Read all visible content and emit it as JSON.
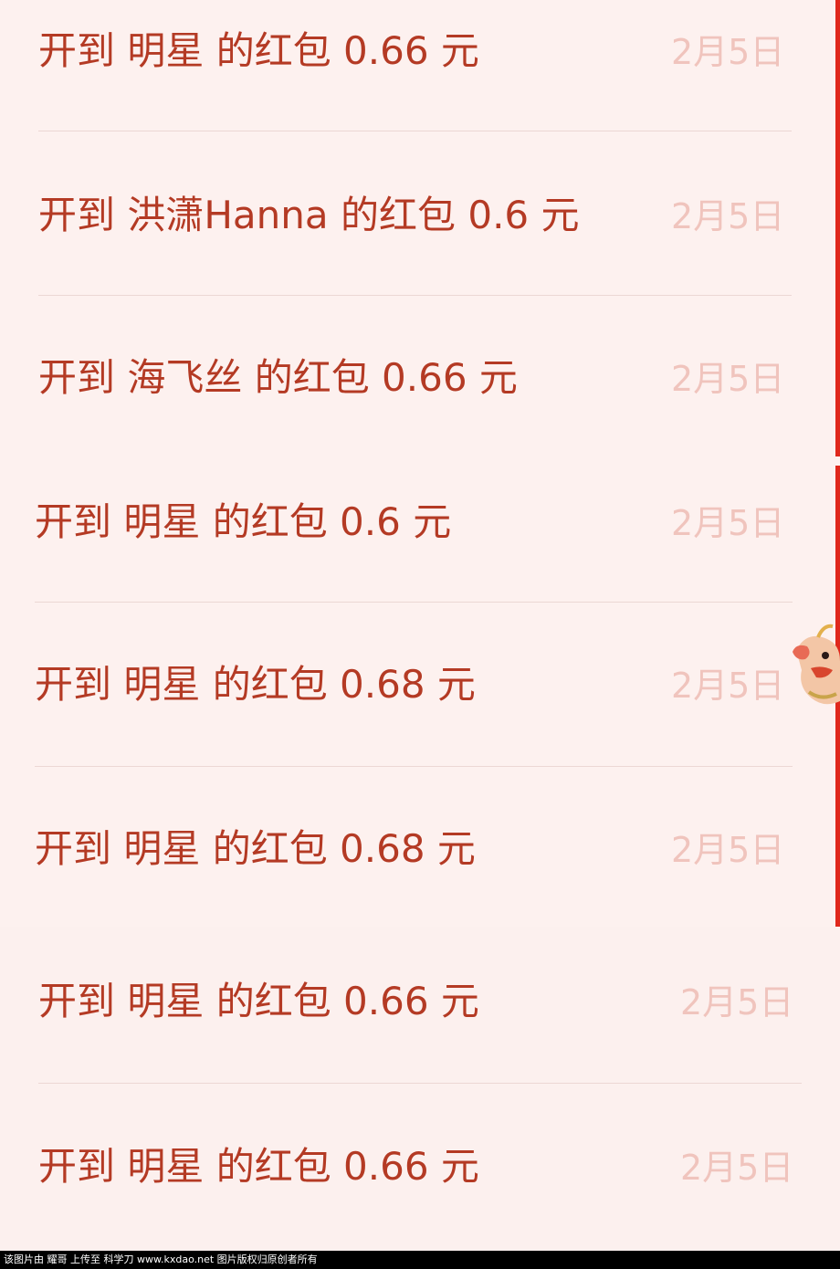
{
  "records": [
    {
      "text": "开到 明星 的红包 0.66 元",
      "date": "2月5日"
    },
    {
      "text": "开到 洪潇Hanna 的红包 0.6 元",
      "date": "2月5日"
    },
    {
      "text": "开到 海飞丝 的红包 0.66 元",
      "date": "2月5日"
    },
    {
      "text": "开到 明星 的红包 0.6 元",
      "date": "2月5日"
    },
    {
      "text": "开到 明星 的红包 0.68 元",
      "date": "2月5日"
    },
    {
      "text": "开到 明星 的红包 0.68 元",
      "date": "2月5日"
    },
    {
      "text": "开到 明星 的红包 0.66 元",
      "date": "2月5日"
    },
    {
      "text": "开到 明星 的红包 0.66 元",
      "date": "2月5日"
    }
  ],
  "footer": {
    "text": "该图片由 耀哥 上传至 科学刀 www.kxdao.net 图片版权归原创者所有"
  },
  "colors": {
    "text": "#b43a24",
    "date": "#f0c4bd",
    "background": "#fdf1ef",
    "accent": "#e0281c"
  },
  "icons": {
    "decoration": "dragon-icon"
  }
}
